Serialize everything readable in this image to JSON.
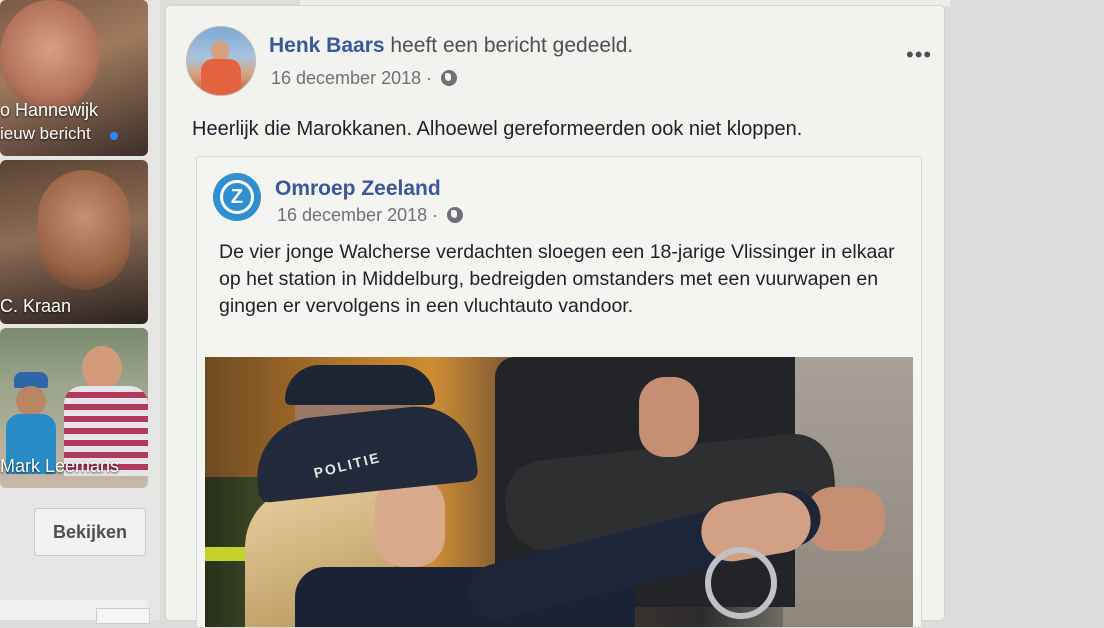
{
  "sidebar": {
    "stories": [
      {
        "line1": "o Hannewijk",
        "line2": "ieuw bericht"
      },
      {
        "line1": "C. Kraan"
      },
      {
        "line1": "Mark Leemans"
      }
    ],
    "view_button": "Bekijken"
  },
  "post": {
    "author_name": "Henk Baars",
    "author_action": "heeft een bericht gedeeld.",
    "date": "16 december 2018 ·",
    "text": "Heerlijk die Marokkanen. Alhoewel gereformeerden ook niet kloppen.",
    "more_label": "•••",
    "shared": {
      "logo_letter": "Z",
      "page_name": "Omroep Zeeland",
      "date": "16 december 2018 ·",
      "text": "De vier jonge Walcherse verdachten sloegen een 18-jarige Vlissinger in elkaar op het station in Middelburg, bedreigden omstanders met een vuurwapen en gingen er vervolgens in een vluchtauto vandoor.",
      "photo_cap_text": "POLITIE"
    }
  },
  "colors": {
    "link_blue": "#385898",
    "card_bg": "#f2f2ef",
    "logo_blue": "#2f8fd0"
  }
}
